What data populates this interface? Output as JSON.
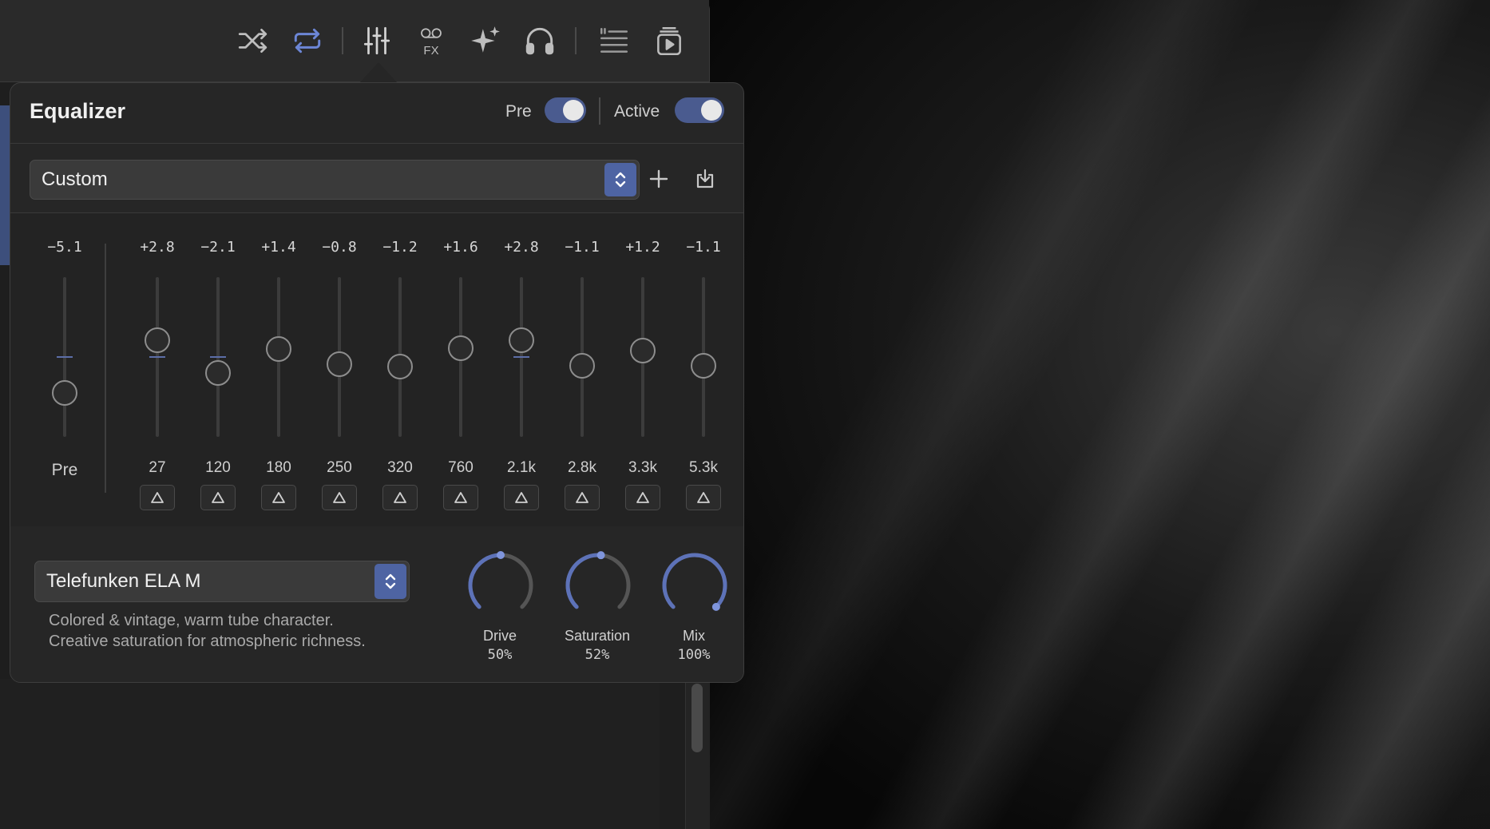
{
  "toolbar": {
    "icons": [
      "shuffle-icon",
      "repeat-icon",
      "equalizer-icon",
      "fx-icon",
      "sparkle-icon",
      "headphones-icon",
      "lyrics-icon",
      "queue-icon"
    ],
    "fx_label": "FX",
    "accent_color": "#6c86d6"
  },
  "equalizer": {
    "title": "Equalizer",
    "pre_label": "Pre",
    "pre_on": true,
    "active_label": "Active",
    "active_on": true,
    "preset": "Custom",
    "preamp": {
      "gain": "−5.1",
      "label": "Pre",
      "level": -5.1
    },
    "bands": [
      {
        "gain": "+2.8",
        "freq": "27",
        "level": 2.8
      },
      {
        "gain": "−2.1",
        "freq": "120",
        "level": -2.1
      },
      {
        "gain": "+1.4",
        "freq": "180",
        "level": 1.4
      },
      {
        "gain": "−0.8",
        "freq": "250",
        "level": -0.8
      },
      {
        "gain": "−1.2",
        "freq": "320",
        "level": -1.2
      },
      {
        "gain": "+1.6",
        "freq": "760",
        "level": 1.6
      },
      {
        "gain": "+2.8",
        "freq": "2.1k",
        "level": 2.8
      },
      {
        "gain": "−1.1",
        "freq": "2.8k",
        "level": -1.1
      },
      {
        "gain": "+1.2",
        "freq": "3.3k",
        "level": 1.2
      },
      {
        "gain": "−1.1",
        "freq": "5.3k",
        "level": -1.1
      }
    ]
  },
  "saturation": {
    "model": "Telefunken ELA M",
    "description_line1": "Colored & vintage, warm tube character.",
    "description_line2": "Creative saturation for atmospheric richness.",
    "knobs": [
      {
        "label": "Drive",
        "value": "50%",
        "level": 0.5
      },
      {
        "label": "Saturation",
        "value": "52%",
        "level": 0.52
      },
      {
        "label": "Mix",
        "value": "100%",
        "level": 1.0
      }
    ]
  }
}
